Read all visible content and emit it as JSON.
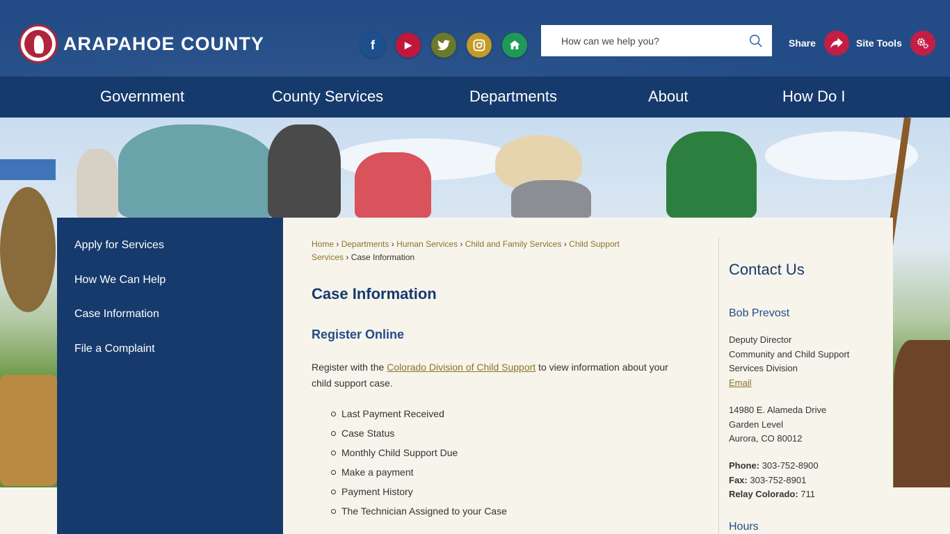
{
  "header": {
    "logo_text": "ARAPAHOE COUNTY",
    "search_placeholder": "How can we help you?",
    "share_label": "Share",
    "site_tools_label": "Site Tools",
    "social": [
      {
        "name": "facebook",
        "glyph": "f",
        "color": "#1c4f8e"
      },
      {
        "name": "youtube",
        "glyph": "▶",
        "color": "#c1173d"
      },
      {
        "name": "twitter",
        "glyph": "🐦",
        "color": "#6b7a2a"
      },
      {
        "name": "instagram",
        "glyph": "◎",
        "color": "#c39a28"
      },
      {
        "name": "nextdoor",
        "glyph": "⌂",
        "color": "#1f9a55"
      }
    ]
  },
  "nav": {
    "items": [
      "Government",
      "County Services",
      "Departments",
      "About",
      "How Do I"
    ]
  },
  "sidebar": {
    "items": [
      "Apply for Services",
      "How We Can Help",
      "Case Information",
      "File a Complaint"
    ]
  },
  "breadcrumb": {
    "items": [
      "Home",
      "Departments",
      "Human Services",
      "Child and Family Services",
      "Child Support Services"
    ],
    "current": "Case Information"
  },
  "main": {
    "title": "Case Information",
    "subtitle": "Register Online",
    "para_before": "Register with the ",
    "para_link": "Colorado Division of Child Support",
    "para_after": " to view information about your child support case.",
    "list": [
      "Last Payment Received",
      "Case Status",
      "Monthly Child Support Due",
      "Make a payment",
      "Payment History",
      "The Technician Assigned to your Case"
    ]
  },
  "contact": {
    "heading": "Contact Us",
    "name": "Bob Prevost",
    "role_line1": "Deputy Director",
    "role_line2": "Community and Child Support",
    "role_line3": "Services Division",
    "email_label": "Email",
    "address_line1": "14980 E. Alameda Drive",
    "address_line2": "Garden Level",
    "address_line3": "Aurora, CO 80012",
    "phone_label": "Phone:",
    "phone": "303-752-8900",
    "fax_label": "Fax:",
    "fax": "303-752-8901",
    "relay_label": "Relay Colorado:",
    "relay": "711",
    "hours_heading": "Hours"
  }
}
